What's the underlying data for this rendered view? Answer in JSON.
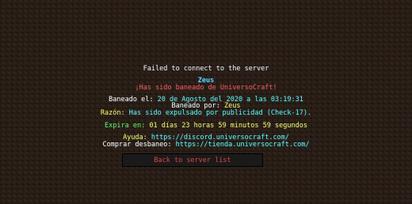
{
  "screen": {
    "title": "Failed to connect to the server",
    "server_name": "Zeus",
    "banned_msg": "¡Has sido baneado de UniversoCraft!",
    "banned_on_label": "Baneado el:",
    "banned_on_value": "20 de Agosto del 2020 a las 03:19:31",
    "banned_by_label": "Baneado por:",
    "banned_by_value": "Zeus",
    "reason_label": "Razón:",
    "reason_value": "Has sido expulsado por publicidad (Check-17).",
    "expires_label": "Expira en:",
    "expires_value": "01 días 23 horas 59 minutos 59 segundos",
    "help_label": "Ayuda:",
    "help_link": "https://discord.universocraft.com/",
    "buy_label": "Comprar desbaneo:",
    "buy_link": "https://tienda.universocraft.com/",
    "back_button": "Back to server list"
  },
  "colors": {
    "server_name": "#55d6ff",
    "banned_msg": "#ff5555",
    "label": "#ffffff",
    "value_yellow": "#ffff55",
    "value_aqua": "#55ffff",
    "expires_green": "#55ff55",
    "button_text": "#d44a4a"
  }
}
